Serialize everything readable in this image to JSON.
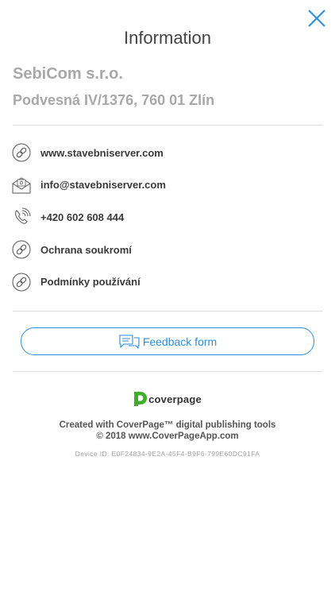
{
  "header": {
    "title": "Information"
  },
  "company": {
    "name": "SebiCom s.r.o.",
    "address": "Podvesná IV/1376, 760 01 Zlín"
  },
  "contacts": [
    {
      "label": "www.stavebniserver.com",
      "icon": "link-icon"
    },
    {
      "label": "info@stavebniserver.com",
      "icon": "mail-icon"
    },
    {
      "label": "+420 602 608 444",
      "icon": "phone-icon"
    },
    {
      "label": "Ochrana soukromí",
      "icon": "link-icon"
    },
    {
      "label": "Podmínky používání",
      "icon": "link-icon"
    }
  ],
  "feedback": {
    "label": "Feedback form",
    "icon": "feedback-chat-icon"
  },
  "brand": {
    "logo_text": "coverpage",
    "logo_color": "#3fae2a"
  },
  "credits": {
    "line1": "Created with CoverPage™ digital publishing tools",
    "line2": "© 2018 www.CoverPageApp.com"
  },
  "device": {
    "id_text": "Device ID: E0F24834-9E2A-45F4-B9F6-799E60DC91FA"
  },
  "colors": {
    "accent": "#2a8ee0",
    "muted_text": "#a8a8a8",
    "divider": "#dcdcdc"
  }
}
